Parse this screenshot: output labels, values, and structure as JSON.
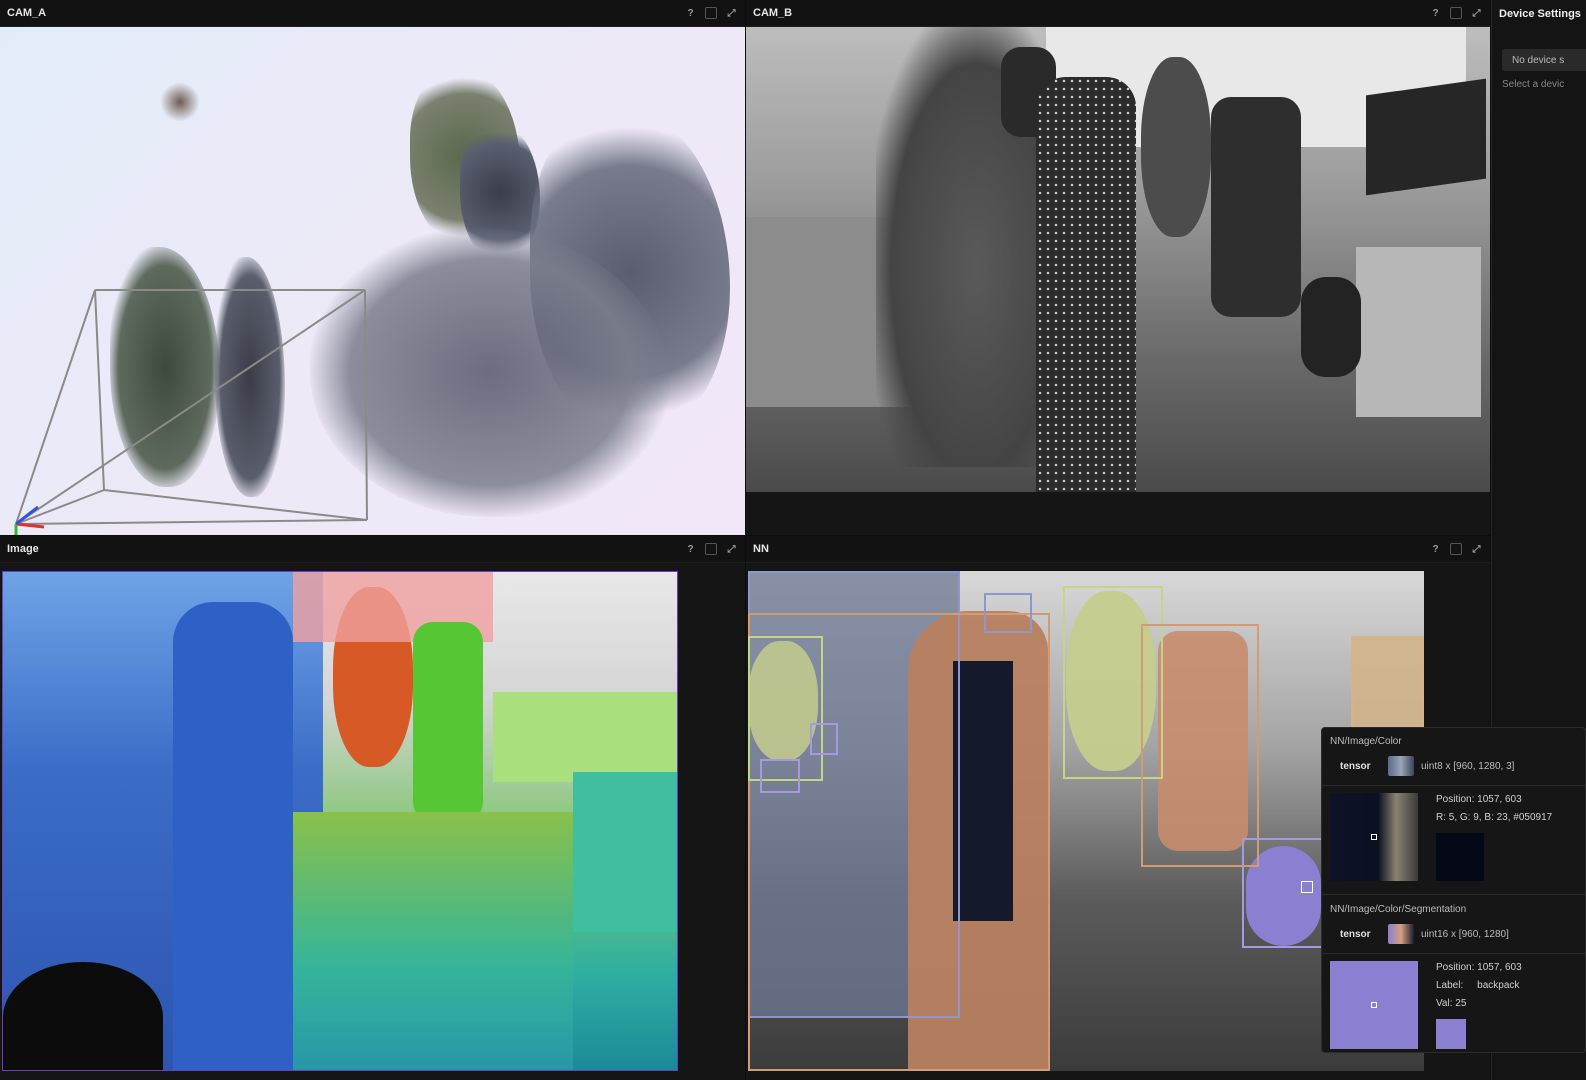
{
  "views": {
    "cam_a": {
      "title": "CAM_A"
    },
    "cam_b": {
      "title": "CAM_B"
    },
    "image": {
      "title": "Image"
    },
    "nn": {
      "title": "NN"
    }
  },
  "header_icons": {
    "help": "?",
    "maximize": "⤢"
  },
  "device_settings": {
    "title": "Device Settings",
    "no_device_button": "No device s",
    "hint": "Select a devic"
  },
  "tooltip": {
    "color": {
      "path": "NN/Image/Color",
      "type_label": "tensor",
      "type_value": "uint8 x [960, 1280, 3]",
      "position_label": "Position:",
      "position_value": "1057, 603",
      "rgb": "R: 5, G: 9, B: 23, #050917",
      "swatch_color": "#050917"
    },
    "segmentation": {
      "path": "NN/Image/Color/Segmentation",
      "type_label": "tensor",
      "type_value": "uint16 x [960, 1280]",
      "position_label": "Position:",
      "position_value": "1057, 603",
      "label_label": "Label:",
      "label_value": "backpack",
      "val_label": "Val:",
      "val_value": "25",
      "swatch_color": "#8a7fd0"
    }
  },
  "colors": {
    "accent_purple": "#6b3cc9",
    "bbox_plant": "#c4d58a",
    "bbox_chair": "#d49a72",
    "bbox_person": "#8f96c8",
    "bbox_backpack": "#a59ae0"
  }
}
